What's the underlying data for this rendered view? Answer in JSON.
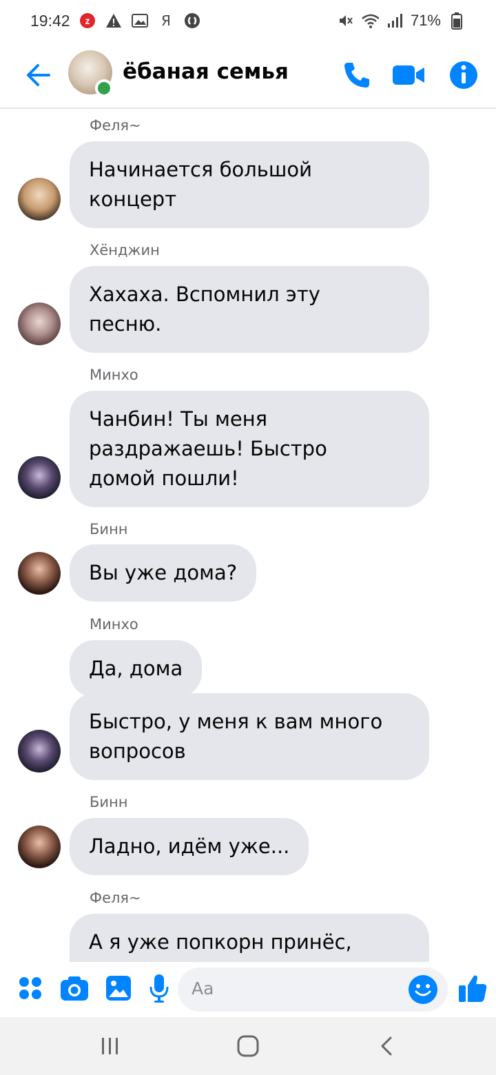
{
  "status_bar": {
    "time": "19:42",
    "battery": "71%",
    "left_icons": [
      "notification-badge-icon",
      "warning-icon",
      "gallery-icon",
      "ya-icon",
      "shazam-icon"
    ],
    "right_icons": [
      "mute-icon",
      "wifi-icon",
      "signal-icon",
      "battery-icon"
    ]
  },
  "header": {
    "title": "ёбаная семья",
    "online": true,
    "icons": [
      "back-arrow-icon",
      "phone-icon",
      "video-call-icon",
      "info-icon"
    ],
    "accent": "#0084ff"
  },
  "messages": [
    {
      "sender": "Феля~",
      "lines": [
        "Начинается большой",
        "концерт"
      ],
      "avatar": "felix"
    },
    {
      "sender": "Хёнджин",
      "lines": [
        "Хахаха. Вспомнил эту",
        "песню."
      ],
      "avatar": "hyunjin"
    },
    {
      "sender": "Минхо",
      "lines": [
        "Чанбин! Ты меня",
        "раздражаешь! Быстро",
        "домой пошли!"
      ],
      "avatar": "minho"
    },
    {
      "sender": "Бинн",
      "lines": [
        "Вы уже дома?"
      ],
      "avatar": "binn"
    },
    {
      "sender": "Минхо",
      "lines": [
        "Да, дома"
      ],
      "avatar": null
    },
    {
      "sender": null,
      "lines": [
        "Быстро, у меня к вам много",
        "вопросов"
      ],
      "avatar": "minho"
    },
    {
      "sender": "Бинн",
      "lines": [
        "Ладно, идём уже..."
      ],
      "avatar": "binn"
    },
    {
      "sender": "Феля~",
      "lines": [
        "А я уже попкорн принёс,"
      ],
      "avatar": null
    }
  ],
  "composer": {
    "placeholder": "Aa",
    "icons": [
      "apps-icon",
      "camera-icon",
      "image-icon",
      "microphone-icon",
      "emoji-icon",
      "like-icon"
    ]
  },
  "nav": {
    "icons": [
      "recent-apps-icon",
      "home-icon",
      "back-icon"
    ]
  },
  "colors": {
    "accent": "#0084ff",
    "bubble": "#e4e6eb",
    "online": "#31a24c",
    "sender_text": "#65676b"
  }
}
